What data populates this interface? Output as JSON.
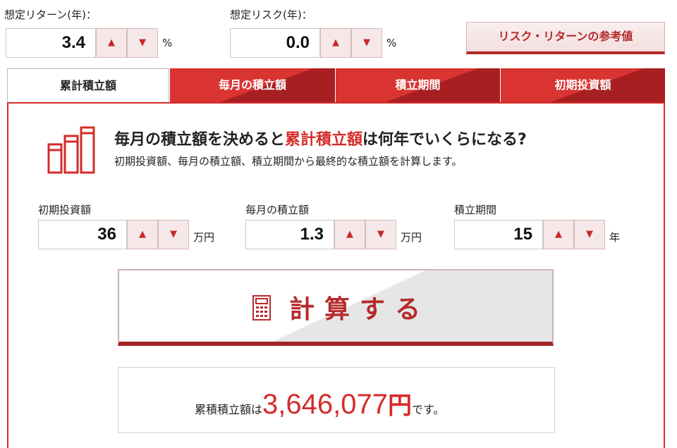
{
  "top": {
    "return_label": "想定リターン(年)：",
    "return_value": "3.4",
    "return_unit": "%",
    "risk_label": "想定リスク(年)：",
    "risk_value": "0.0",
    "risk_unit": "%",
    "reference_button": "リスク・リターンの参考値",
    "up_glyph": "▲",
    "down_glyph": "▼"
  },
  "tabs": [
    {
      "label": "累計積立額",
      "active": true
    },
    {
      "label": "毎月の積立額",
      "active": false
    },
    {
      "label": "積立期間",
      "active": false
    },
    {
      "label": "初期投資額",
      "active": false
    }
  ],
  "panel": {
    "headline_pre": "毎月の積立額を決めると",
    "headline_highlight": "累計積立額",
    "headline_post": "は何年でいくらになる?",
    "subline": "初期投資額、毎月の積立額、積立期間から最終的な積立額を計算します。",
    "icon": "bar-chart-icon"
  },
  "fields": [
    {
      "label": "初期投資額",
      "value": "36",
      "unit": "万円"
    },
    {
      "label": "毎月の積立額",
      "value": "1.3",
      "unit": "万円"
    },
    {
      "label": "積立期間",
      "value": "15",
      "unit": "年"
    }
  ],
  "calculate_button": "計算する",
  "result": {
    "prefix": "累積積立額は",
    "amount": "3,646,077",
    "yen": "円",
    "suffix": "です。"
  },
  "colors": {
    "accent_red": "#d42c2a",
    "dark_red": "#a81f22"
  }
}
